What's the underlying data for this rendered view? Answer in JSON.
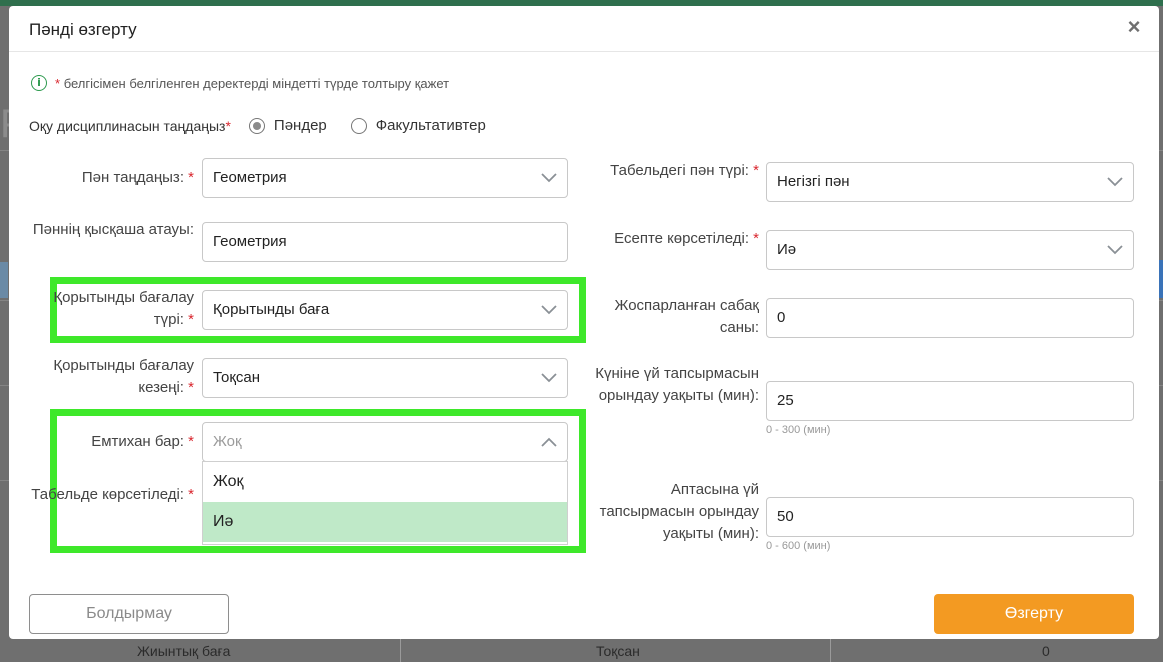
{
  "modal": {
    "title": "Пәнді өзгерту",
    "notice": "белгісімен белгіленген деректерді міндетті түрде толтыру қажет",
    "required_mark": "*",
    "discipline": {
      "label": "Оқу дисциплинасын таңдаңыз",
      "options": [
        "Пәндер",
        "Факультативтер"
      ],
      "selected": "Пәндер"
    },
    "left": {
      "subject": {
        "label": "Пән таңдаңыз:",
        "value": "Геометрия"
      },
      "short_name": {
        "label": "Пәннің қысқаша атауы:",
        "value": "Геометрия"
      },
      "final_type": {
        "label": "Қорытынды бағалау түрі:",
        "value": "Қорытынды баға"
      },
      "final_period": {
        "label": "Қорытынды бағалау кезеңі:",
        "value": "Тоқсан"
      },
      "exam": {
        "label": "Емтихан бар:",
        "value": "Жоқ",
        "options": [
          "Жоқ",
          "Иә"
        ],
        "highlighted": "Иә"
      },
      "tabel_shown": {
        "label": "Табельде көрсетіледі:"
      }
    },
    "right": {
      "tabel_type": {
        "label": "Табельдегі пән түрі:",
        "value": "Негізгі пән"
      },
      "report_shown": {
        "label": "Есепте көрсетіледі:",
        "value": "Иә"
      },
      "planned_lessons": {
        "label": "Жоспарланған сабақ саны:",
        "value": "0"
      },
      "daily_homework": {
        "label": "Күніне үй тапсырмасын орындау уақыты (мин):",
        "value": "25",
        "hint": "0 - 300 (мин)"
      },
      "weekly_homework": {
        "label": "Аптасына үй тапсырмасын орындау уақыты (мин):",
        "value": "50",
        "hint": "0 - 600 (мин)"
      }
    },
    "buttons": {
      "cancel": "Болдырмау",
      "save": "Өзгерту"
    }
  },
  "background": {
    "letter": "Р",
    "footer_cells": [
      "Жиынтық баға",
      "Тоқсан",
      "0"
    ]
  },
  "colors": {
    "accent": "#f39a22",
    "highlight": "#3ee82a",
    "option_hover": "#bfe9c8",
    "required": "#d9262e",
    "info": "#2e9a4f"
  },
  "icons": {
    "close": "close-icon",
    "info": "info-icon",
    "chevron_down": "chevron-down-icon",
    "chevron_up": "chevron-up-icon"
  }
}
